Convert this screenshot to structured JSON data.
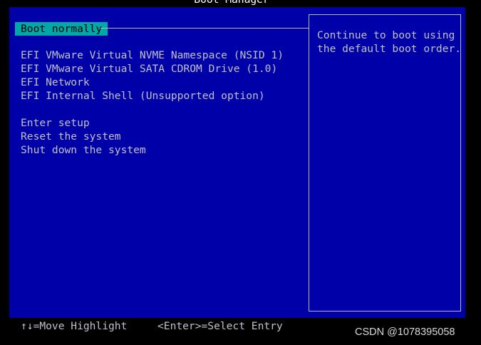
{
  "window": {
    "title": "Boot Manager"
  },
  "menu": {
    "selected_index": 0,
    "items": [
      {
        "label": "Boot normally"
      },
      {
        "label": "EFI VMware Virtual NVME Namespace (NSID 1)"
      },
      {
        "label": "EFI VMware Virtual SATA CDROM Drive (1.0)"
      },
      {
        "label": "EFI Network"
      },
      {
        "label": "EFI Internal Shell (Unsupported option)"
      },
      {
        "label": "Enter setup"
      },
      {
        "label": "Reset the system"
      },
      {
        "label": "Shut down the system"
      }
    ]
  },
  "help": {
    "lines": [
      "Continue to boot using",
      "the default boot order."
    ]
  },
  "footer": {
    "move_hint": "↑↓=Move Highlight",
    "select_hint": "<Enter>=Select Entry"
  },
  "watermark": {
    "text": "CSDN @1078395058"
  },
  "colors": {
    "background": "#0000a8",
    "highlight": "#00a8a8",
    "text": "#c0c0cc",
    "title": "#ffffff"
  }
}
